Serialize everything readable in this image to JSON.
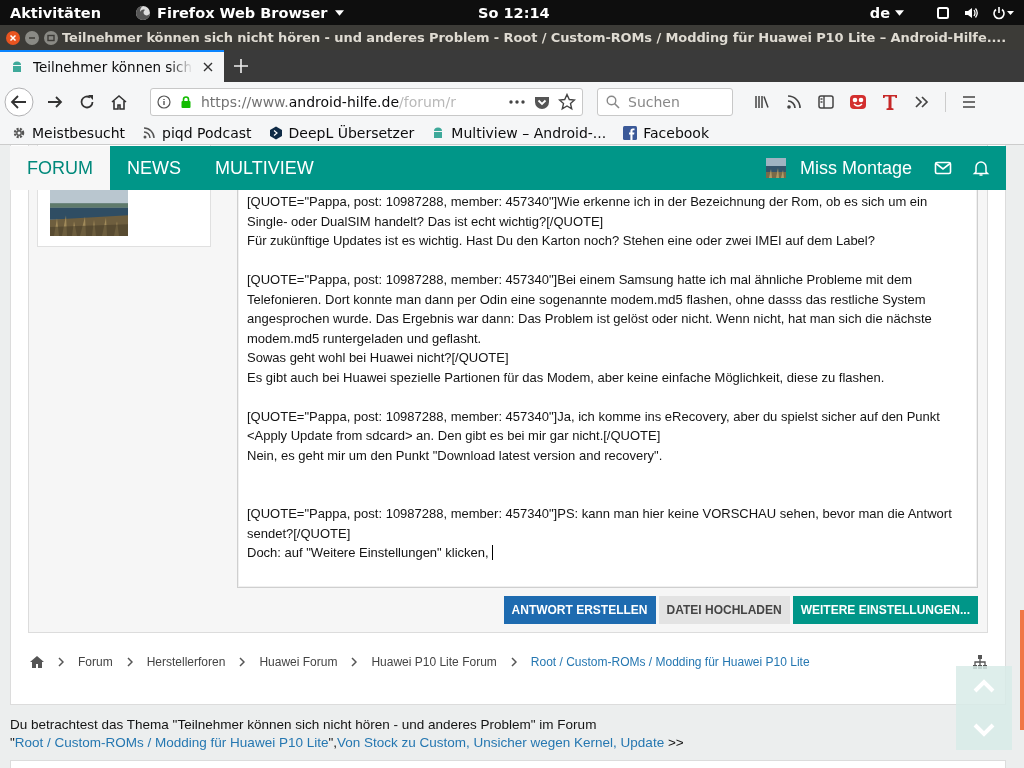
{
  "system_bar": {
    "activities": "Aktivitäten",
    "app_menu": "Firefox Web Browser",
    "clock": "So 12:14",
    "keyboard": "de"
  },
  "window": {
    "title": "Teilnehmer können sich nicht hören - und anderes Problem - Root / Custom-ROMs / Modding für Huawei P10 Lite – Android-Hilfe...."
  },
  "tabs": [
    {
      "label": "Teilnehmer können sich",
      "selected": true
    }
  ],
  "toolbar": {
    "url_prefix": "https://www.",
    "url_domain": "android-hilfe.de",
    "url_path": "/forum/r",
    "search": {
      "placeholder": "Suchen"
    }
  },
  "bookmarks": [
    {
      "label": "Meistbesucht",
      "kind": "folder"
    },
    {
      "label": "piqd Podcast",
      "kind": "feed"
    },
    {
      "label": "DeepL Übersetzer",
      "kind": "deepl"
    },
    {
      "label": "Multiview – Android-...",
      "kind": "android"
    },
    {
      "label": "Facebook",
      "kind": "facebook"
    }
  ],
  "site_nav": {
    "tabs": [
      {
        "label": "FORUM",
        "selected": true
      },
      {
        "label": "NEWS",
        "selected": false
      },
      {
        "label": "MULTIVIEW",
        "selected": false
      }
    ],
    "user": "Miss Montage"
  },
  "editor": {
    "value": "[QUOTE=\"Pappa, post: 10987288, member: 457340\"]Wie erkenne ich in der Bezeichnung der Rom, ob es sich um ein Single- oder DualSIM handelt? Das ist echt wichtig?[/QUOTE]\nFür zukünftige Updates ist es wichtig. Hast Du den Karton noch? Stehen eine oder zwei IMEI auf dem Label?\n\n[QUOTE=\"Pappa, post: 10987288, member: 457340\"]Bei einem Samsung hatte ich mal ähnliche Probleme mit dem Telefonieren. Dort konnte man dann per Odin eine sogenannte modem.md5 flashen, ohne dasss das restliche System angesprochen wurde. Das Ergebnis war dann: Das Problem ist gelöst oder nicht. Wenn nicht, hat man sich die nächste modem.md5 runtergeladen und geflasht.\nSowas geht wohl bei Huawei nicht?[/QUOTE]\nEs gibt auch bei Huawei spezielle Partionen für das Modem, aber keine einfache Möglichkeit, diese zu flashen.\n\n[QUOTE=\"Pappa, post: 10987288, member: 457340\"]Ja, ich komme ins eRecovery, aber du spielst sicher auf den Punkt <Apply Update from sdcard> an. Den gibt es bei mir gar nicht.[/QUOTE]\nNein, es geht mir um den Punkt \"Download latest version and recovery\".\n\n\n[QUOTE=\"Pappa, post: 10987288, member: 457340\"]PS: kann man hier keine VORSCHAU sehen, bevor man die Antwort sendet?[/QUOTE]\nDoch: auf \"Weitere Einstellungen\" klicken, ",
    "focused": true
  },
  "buttons": [
    {
      "label": "ANTWORT ERSTELLEN",
      "kind": "primary"
    },
    {
      "label": "DATEI HOCHLADEN",
      "kind": "secondary"
    },
    {
      "label": "WEITERE EINSTELLUNGEN...",
      "kind": "accent"
    }
  ],
  "breadcrumb": [
    {
      "label": "Forum",
      "current": false
    },
    {
      "label": "Herstellerforen",
      "current": false
    },
    {
      "label": "Huawei Forum",
      "current": false
    },
    {
      "label": "Huawei P10 Lite Forum",
      "current": false
    },
    {
      "label": "Root / Custom-ROMs / Modding für Huawei P10 Lite",
      "current": true
    }
  ],
  "topic_info": [
    {
      "kind": "text",
      "text": "Du betrachtest das Thema \"Teilnehmer können sich nicht hören - und anderes Problem\" im Forum \""
    },
    {
      "kind": "link",
      "text": "Root / Custom-ROMs / Modding für Huawei P10 Lite"
    },
    {
      "kind": "text",
      "text": "\","
    },
    {
      "kind": "link",
      "text": "Von Stock zu Custom, Unsicher wegen Kernel, Update"
    },
    {
      "kind": "text",
      "text": " >>"
    }
  ]
}
